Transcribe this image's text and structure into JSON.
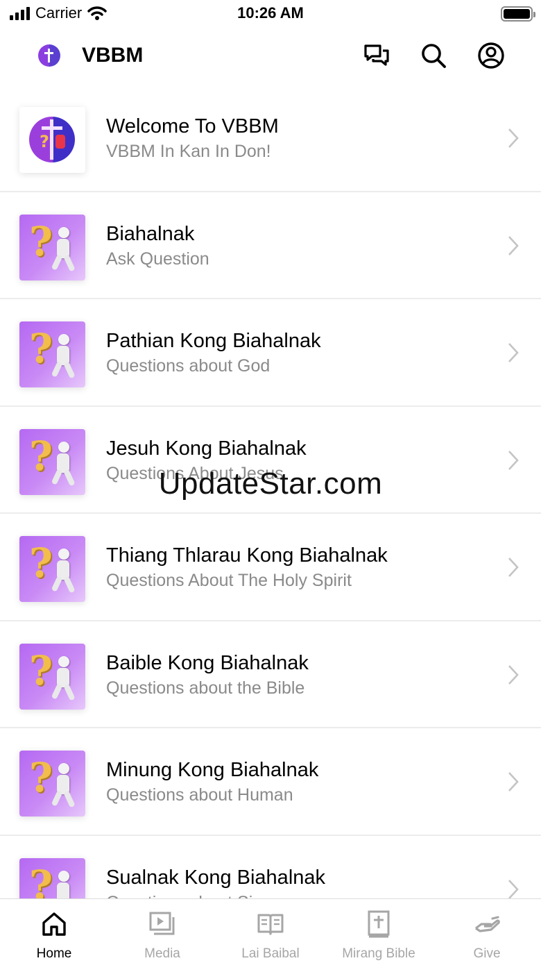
{
  "status_bar": {
    "carrier": "Carrier",
    "time": "10:26 AM"
  },
  "header": {
    "title": "VBBM",
    "icons": [
      "chat-icon",
      "search-icon",
      "account-icon"
    ]
  },
  "list": [
    {
      "title": "Welcome To VBBM",
      "subtitle": "VBBM In Kan In Don!",
      "thumb": "vbbm-logo"
    },
    {
      "title": "Biahalnak",
      "subtitle": "Ask Question",
      "thumb": "question-figure"
    },
    {
      "title": "Pathian Kong Biahalnak",
      "subtitle": "Questions about God",
      "thumb": "question-figure"
    },
    {
      "title": "Jesuh Kong Biahalnak",
      "subtitle": "Questions About Jesus",
      "thumb": "question-figure"
    },
    {
      "title": "Thiang Thlarau Kong Biahalnak",
      "subtitle": "Questions About The Holy Spirit",
      "thumb": "question-figure"
    },
    {
      "title": "Baible Kong Biahalnak",
      "subtitle": "Questions about the Bible",
      "thumb": "question-figure"
    },
    {
      "title": "Minung Kong Biahalnak",
      "subtitle": "Questions about Human",
      "thumb": "question-figure"
    },
    {
      "title": "Sualnak Kong Biahalnak",
      "subtitle": "Questions about Sin",
      "thumb": "question-figure"
    }
  ],
  "watermark": "UpdateStar.com",
  "tabs": [
    {
      "label": "Home",
      "icon": "home-icon",
      "active": true
    },
    {
      "label": "Media",
      "icon": "media-icon",
      "active": false
    },
    {
      "label": "Lai Baibal",
      "icon": "book-icon",
      "active": false
    },
    {
      "label": "Mirang Bible",
      "icon": "bible-icon",
      "active": false
    },
    {
      "label": "Give",
      "icon": "give-icon",
      "active": false
    }
  ],
  "colors": {
    "accent": "#b569f2",
    "tab_active": "#000000",
    "tab_inactive": "#a6a6a6",
    "subtitle": "#8a8a8a"
  }
}
